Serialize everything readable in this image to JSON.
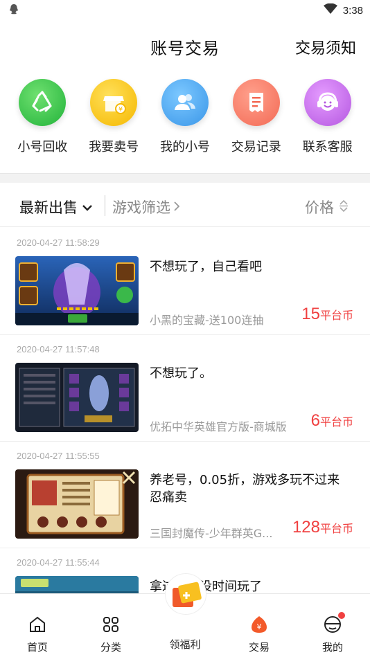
{
  "status": {
    "time": "3:38"
  },
  "header": {
    "title": "账号交易",
    "notice_link": "交易须知"
  },
  "quick_actions": [
    {
      "label": "小号回收",
      "icon": "recycle-icon",
      "color": "#3cc84a"
    },
    {
      "label": "我要卖号",
      "icon": "shop-icon",
      "color": "#f7c51c"
    },
    {
      "label": "我的小号",
      "icon": "users-icon",
      "color": "#4aa8f0"
    },
    {
      "label": "交易记录",
      "icon": "receipt-icon",
      "color": "#f77a66"
    },
    {
      "label": "联系客服",
      "icon": "headset-icon",
      "color": "#c76ae8"
    }
  ],
  "filters": {
    "latest": "最新出售",
    "game": "游戏筛选",
    "price": "价格"
  },
  "listings": [
    {
      "time": "2020-04-27 11:58:29",
      "title": "不想玩了，自己看吧",
      "game": "小黑的宝藏-送100连抽",
      "price": "15",
      "unit": "平台币"
    },
    {
      "time": "2020-04-27 11:57:48",
      "title": "不想玩了。",
      "game": "优拓中华英雄官方版-商城版",
      "price": "6",
      "unit": "平台币"
    },
    {
      "time": "2020-04-27 11:55:55",
      "title": "养老号，0.05折，游戏多玩不过来忍痛卖",
      "game": "三国封魔传-少年群英G...",
      "price": "128",
      "unit": "平台币"
    },
    {
      "time": "2020-04-27 11:55:44",
      "title": "拿过榜一没时间玩了",
      "game": "",
      "price": "",
      "unit": ""
    }
  ],
  "tabs": [
    {
      "label": "首页",
      "icon": "home-icon"
    },
    {
      "label": "分类",
      "icon": "grid-icon"
    },
    {
      "label": "领福利",
      "icon": "gift-icon"
    },
    {
      "label": "交易",
      "icon": "money-bag-icon",
      "active": true
    },
    {
      "label": "我的",
      "icon": "profile-icon"
    }
  ],
  "colors": {
    "accent": "#f04040",
    "active_tab": "#f35a2a"
  }
}
